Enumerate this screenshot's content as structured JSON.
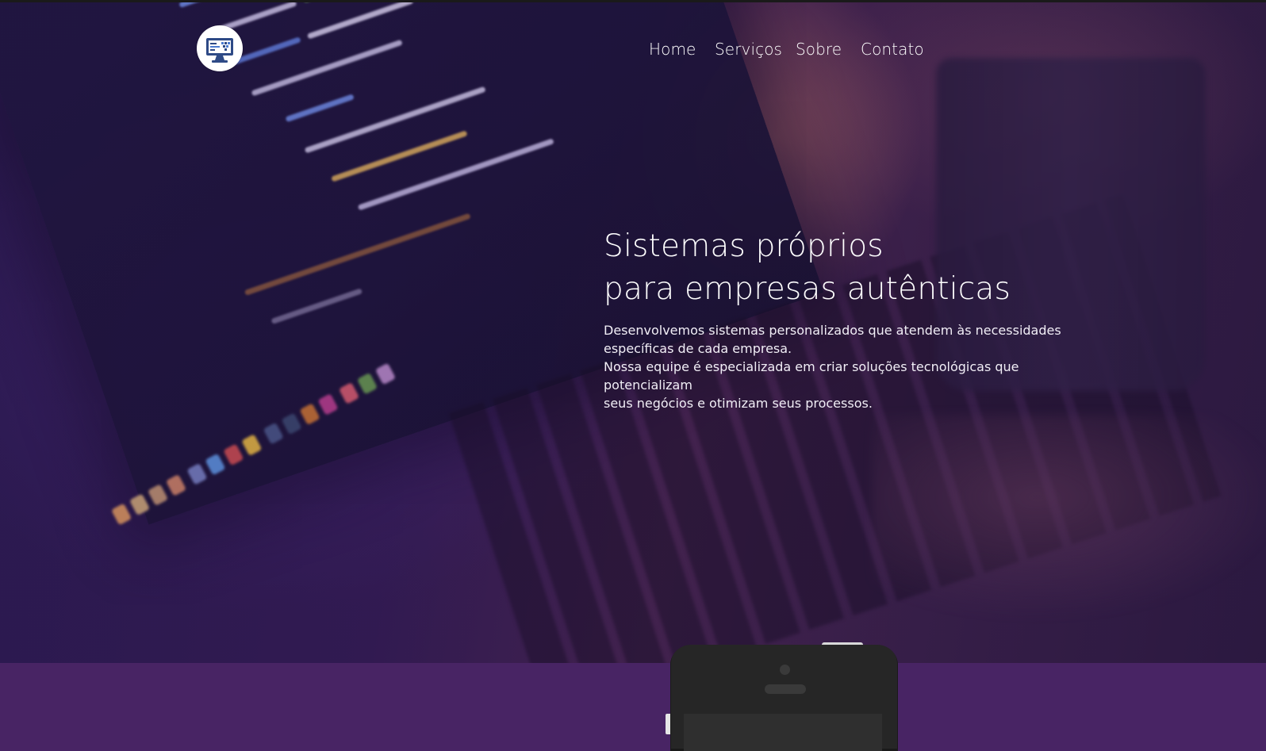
{
  "brand": {
    "logo": "monitor-code-logo-icon"
  },
  "nav": {
    "items": [
      {
        "label": "Home"
      },
      {
        "label": "Serviços"
      },
      {
        "label": "Sobre"
      },
      {
        "label": "Contato"
      }
    ]
  },
  "hero": {
    "headline_line1": "Sistemas próprios",
    "headline_line2": "para empresas autênticas",
    "paragraph1_line1": "Desenvolvemos sistemas personalizados que atendem às necessidades",
    "paragraph1_line2": "específicas de cada empresa.",
    "paragraph2_line1": "Nossa equipe é especializada em criar soluções tecnológicas que potencializam",
    "paragraph2_line2": "seus negócios e otimizam seus processos."
  },
  "colors": {
    "accent_band": "#482464",
    "hero_overlay": "#2b1b52",
    "text": "#ffffff"
  }
}
